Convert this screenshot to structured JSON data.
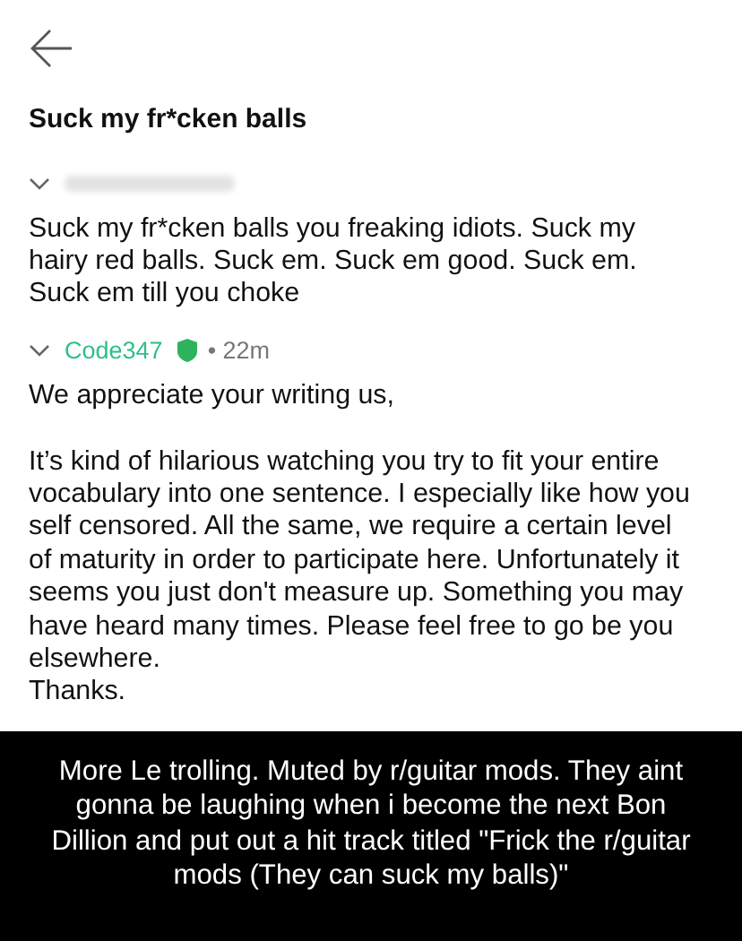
{
  "thread": {
    "title": "Suck my fr*cken balls",
    "messages": [
      {
        "author_hidden": true,
        "expanded": true,
        "body": "Suck my fr*cken balls you freaking idiots. Suck my hairy red balls. Suck em. Suck em good. Suck em. Suck em till you choke"
      },
      {
        "author_hidden": false,
        "author": "Code347",
        "moderator": true,
        "time": "• 22m",
        "expanded": true,
        "body": "We appreciate your writing us,\n\nIt’s kind of hilarious watching you try to fit your entire vocabulary into one sentence. I especially like how you self censored. All the same, we require a certain level of maturity in order to participate here. Unfortunately it seems you just don't measure up. Something you may have heard many times. Please feel free to go be you elsewhere.\nThanks."
      }
    ]
  },
  "caption": "More Le trolling. Muted by r/guitar mods. They aint gonna be laughing when i become the next Bon Dillion and put out a hit track titled \"Frick the r/guitar mods (They can suck my balls)\""
}
